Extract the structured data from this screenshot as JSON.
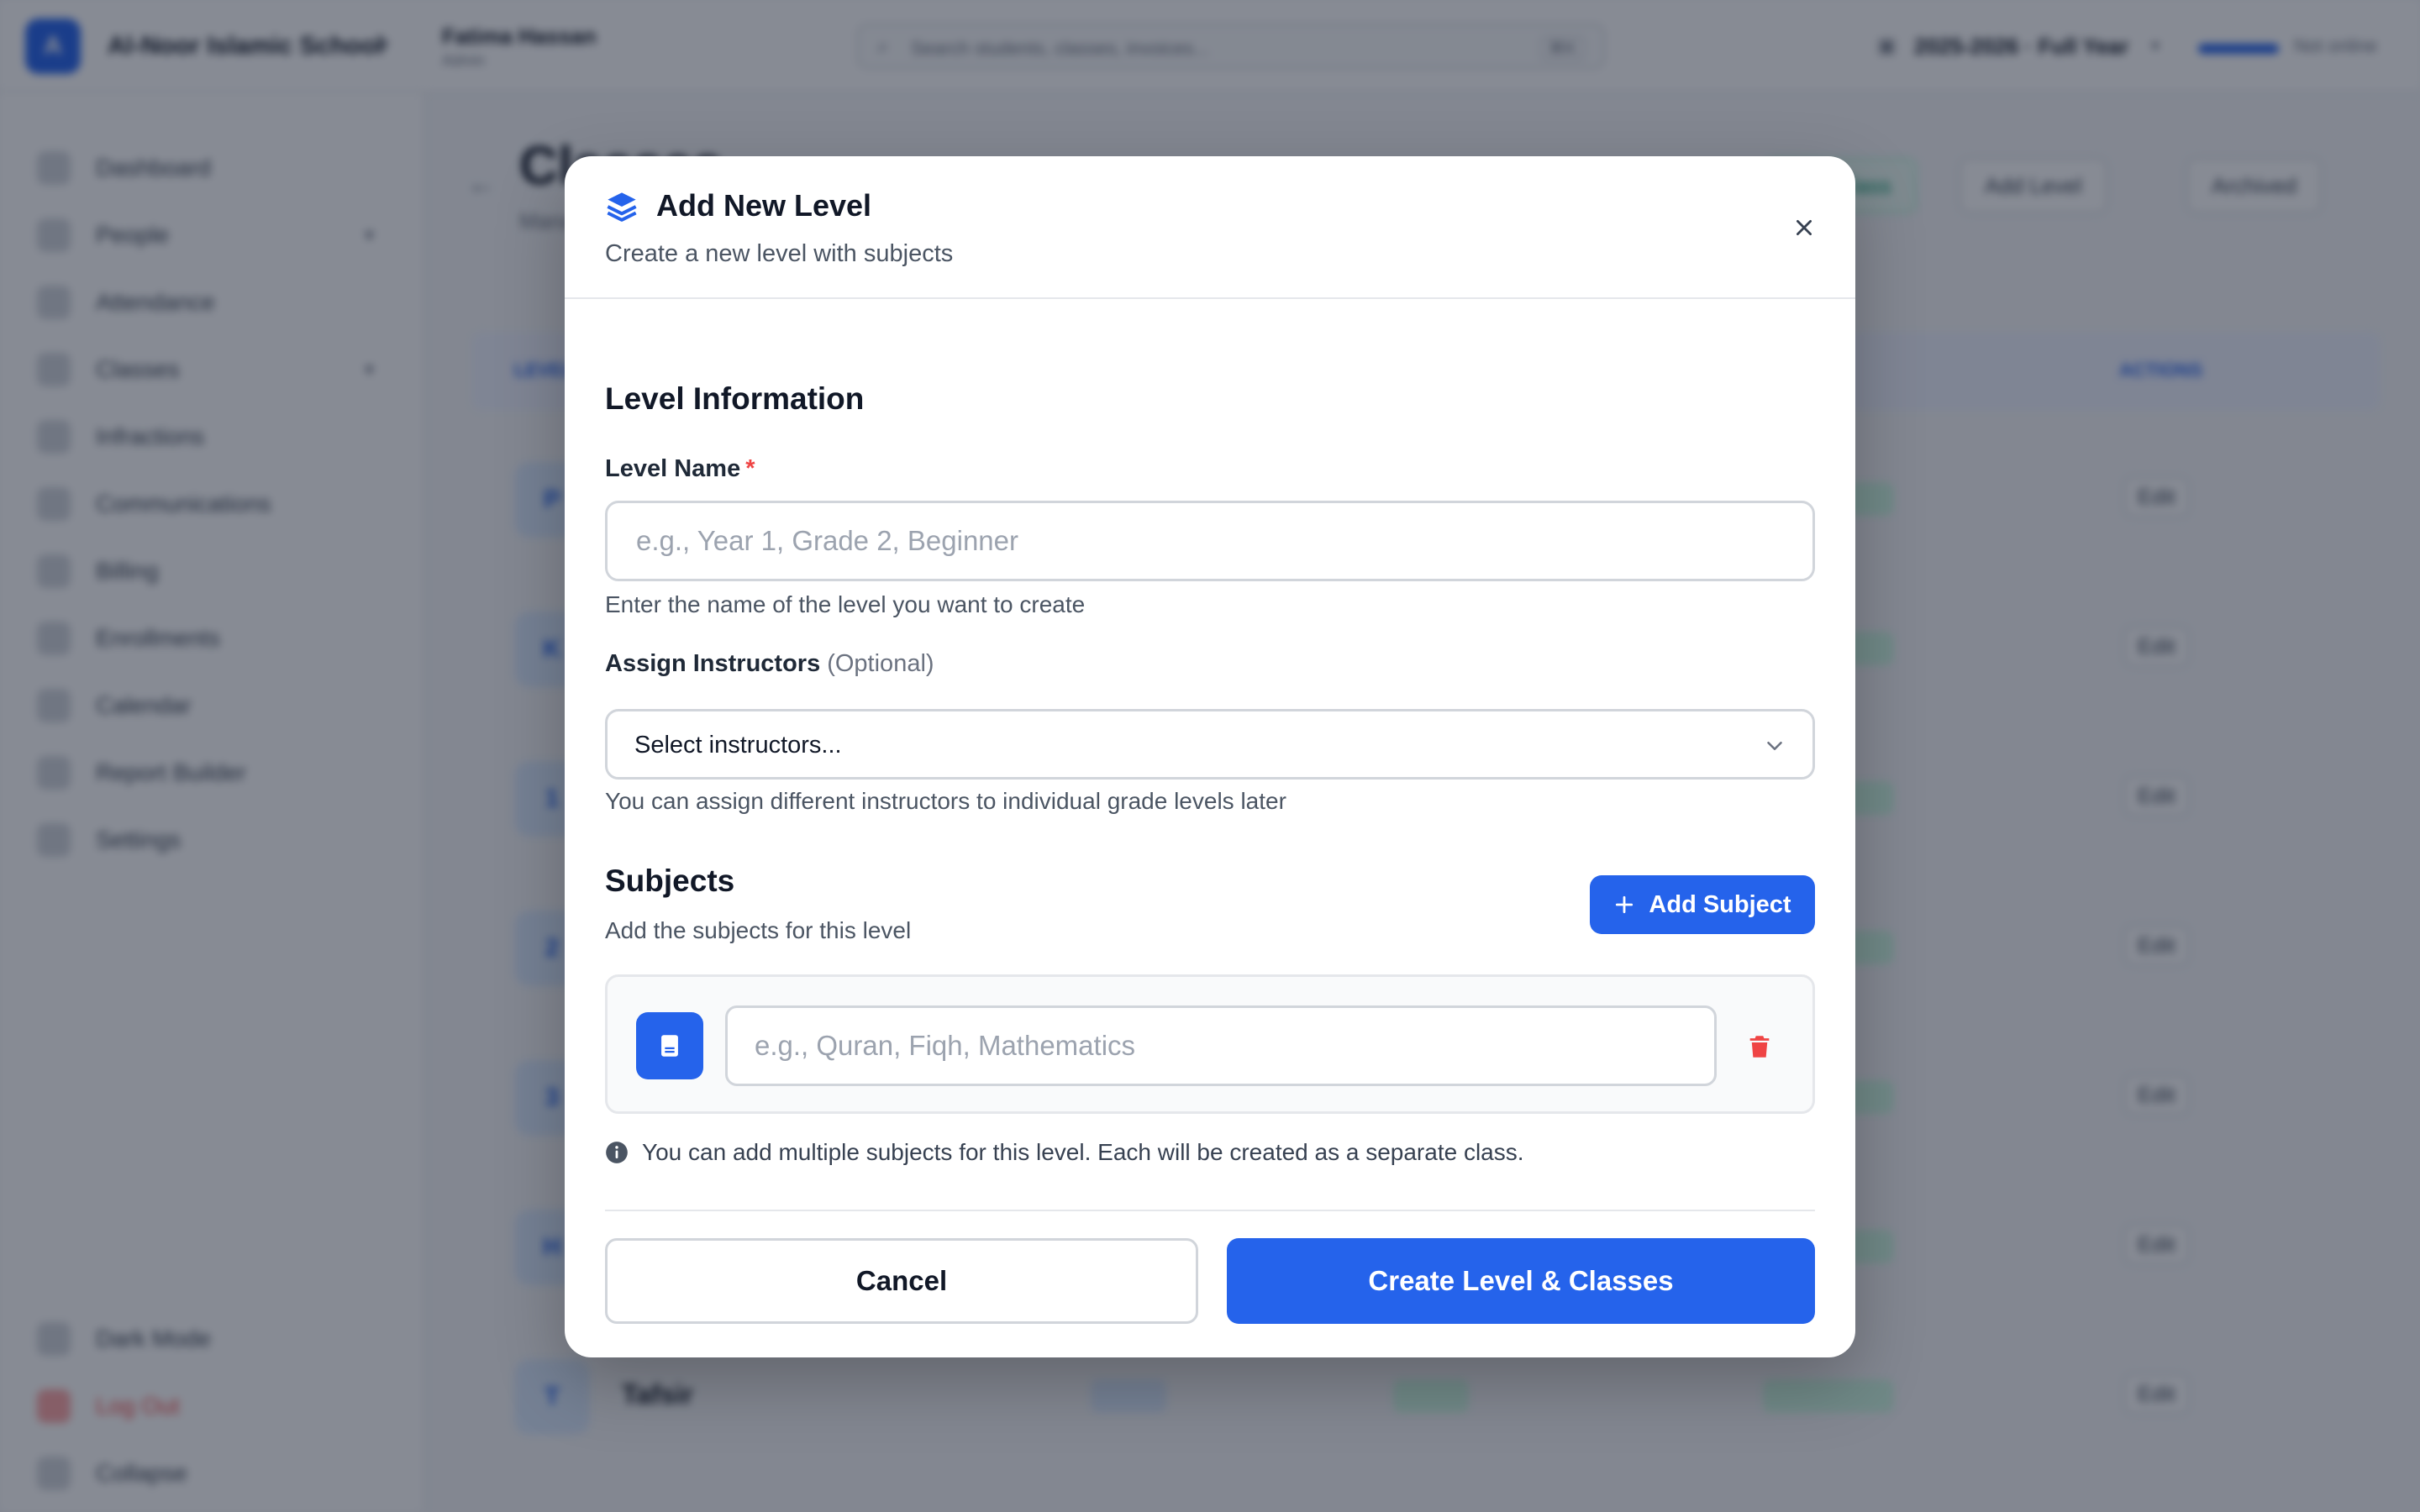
{
  "background": {
    "school_name": "Al-Noor Islamic School",
    "user_name": "Fatima Hassan",
    "user_role": "Admin",
    "search_placeholder": "Search students, classes, invoices...",
    "search_shortcut": "⌘K",
    "academic_year": "2025-2026 · Full Year",
    "sync_status": "Not online",
    "nav": [
      {
        "label": "Dashboard",
        "icon": "dashboard-icon"
      },
      {
        "label": "People",
        "icon": "people-icon",
        "expandable": true
      },
      {
        "label": "Attendance",
        "icon": "attendance-icon"
      },
      {
        "label": "Classes",
        "icon": "classes-icon",
        "expandable": true
      },
      {
        "label": "Infractions",
        "icon": "infractions-icon"
      },
      {
        "label": "Communications",
        "icon": "communications-icon"
      },
      {
        "label": "Billing",
        "icon": "billing-icon"
      },
      {
        "label": "Enrollments",
        "icon": "enrollments-icon"
      },
      {
        "label": "Calendar",
        "icon": "calendar-icon"
      },
      {
        "label": "Report Builder",
        "icon": "report-icon"
      },
      {
        "label": "Settings",
        "icon": "settings-icon"
      }
    ],
    "nav_bottom": [
      {
        "label": "Dark Mode",
        "icon": "moon-icon"
      },
      {
        "label": "Log Out",
        "icon": "logout-icon"
      },
      {
        "label": "Collapse",
        "icon": "collapse-icon"
      }
    ],
    "page_title": "Classes",
    "page_subtitle": "Manage levels and classes",
    "header_buttons": [
      "Add Class",
      "Add Level",
      "Archived"
    ],
    "table_headers": [
      "LEVEL",
      "ACTIONS"
    ],
    "rows": [
      {
        "initial": "P",
        "name": "",
        "edit": "Edit"
      },
      {
        "initial": "K",
        "name": "",
        "edit": "Edit"
      },
      {
        "initial": "1",
        "name": "",
        "edit": "Edit"
      },
      {
        "initial": "2",
        "name": "",
        "edit": "Edit"
      },
      {
        "initial": "3",
        "name": "",
        "edit": "Edit"
      },
      {
        "initial": "H",
        "name": "",
        "edit": "Edit"
      },
      {
        "initial": "T",
        "name": "Tafsir",
        "edit": "Edit"
      }
    ]
  },
  "modal": {
    "title": "Add New Level",
    "subtitle": "Create a new level with subjects",
    "level_info": {
      "heading": "Level Information",
      "name_label": "Level Name",
      "required_mark": "*",
      "name_value": "",
      "name_placeholder": "e.g., Year 1, Grade 2, Beginner",
      "name_helper": "Enter the name of the level you want to create",
      "instructors_label": "Assign Instructors",
      "instructors_optional": "(Optional)",
      "instructors_value": "Select instructors...",
      "instructors_helper": "You can assign different instructors to individual grade levels later"
    },
    "subjects": {
      "heading": "Subjects",
      "subheading": "Add the subjects for this level",
      "add_button": "Add Subject",
      "items": [
        {
          "value": "",
          "placeholder": "e.g., Quran, Fiqh, Mathematics"
        }
      ],
      "info_note": "You can add multiple subjects for this level. Each will be created as a separate class."
    },
    "footer": {
      "cancel_label": "Cancel",
      "create_label": "Create Level & Classes"
    },
    "colors": {
      "primary": "#2563eb",
      "danger": "#ef4444",
      "border": "#d1d5db"
    }
  }
}
